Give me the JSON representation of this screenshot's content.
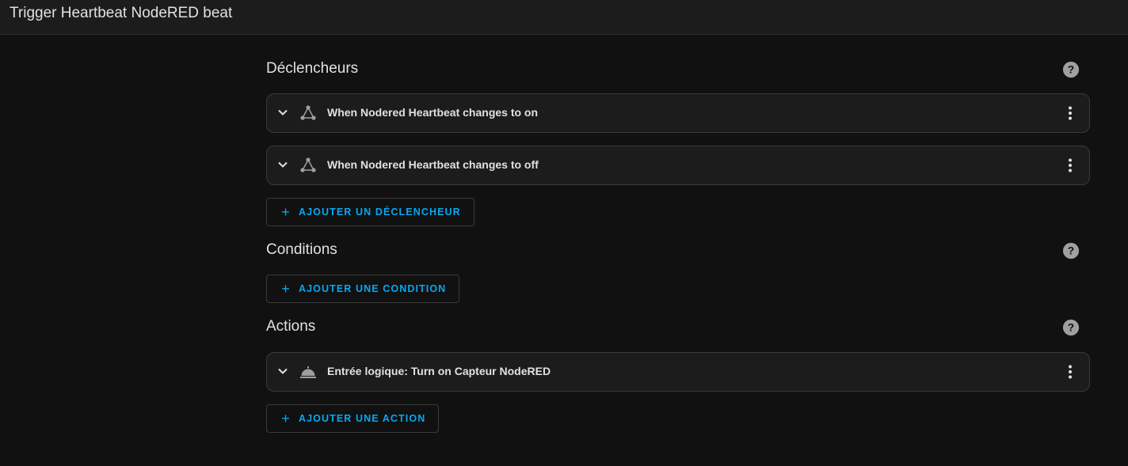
{
  "header": {
    "title": "Trigger Heartbeat NodeRED beat"
  },
  "sections": {
    "triggers": {
      "title": "Déclencheurs",
      "items": [
        {
          "label": "When Nodered Heartbeat changes to on",
          "icon": "state-trigger-icon"
        },
        {
          "label": "When Nodered Heartbeat changes to off",
          "icon": "state-trigger-icon"
        }
      ],
      "add_label": "AJOUTER UN DÉCLENCHEUR"
    },
    "conditions": {
      "title": "Conditions",
      "add_label": "AJOUTER UNE CONDITION"
    },
    "actions": {
      "title": "Actions",
      "items": [
        {
          "label": "Entrée logique: Turn on Capteur NodeRED",
          "icon": "service-bell-icon"
        }
      ],
      "add_label": "AJOUTER UNE ACTION"
    }
  },
  "colors": {
    "background": "#111111",
    "card": "#1c1c1c",
    "accent": "#03a9f4",
    "text": "#e1e1e1",
    "icon": "#9e9e9e"
  }
}
